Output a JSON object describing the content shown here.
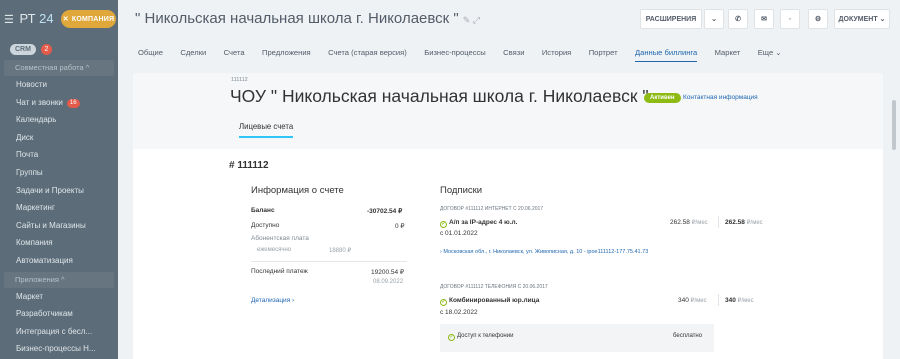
{
  "app": {
    "menu_icon": "menu-icon",
    "name": "РТ",
    "number": "24",
    "company_label": "КОМПАНИЯ"
  },
  "sidebar": {
    "crm_label": "CRM",
    "crm_count": "2",
    "group_work": "Совместная работа",
    "items_top": [
      {
        "label": "Новости",
        "count": ""
      },
      {
        "label": "Чат и звонки",
        "count": "16"
      },
      {
        "label": "Календарь",
        "count": ""
      },
      {
        "label": "Диск",
        "count": ""
      },
      {
        "label": "Почта",
        "count": ""
      },
      {
        "label": "Группы",
        "count": ""
      },
      {
        "label": "Задачи и Проекты",
        "count": ""
      },
      {
        "label": "Маркетинг",
        "count": ""
      },
      {
        "label": "Сайты и Магазины",
        "count": ""
      },
      {
        "label": "Компания",
        "count": ""
      },
      {
        "label": "Автоматизация",
        "count": ""
      }
    ],
    "group_apps": "Приложения",
    "items_bottom": [
      {
        "label": "Маркет"
      },
      {
        "label": "Разработчикам"
      },
      {
        "label": "Интеграция с бесл..."
      },
      {
        "label": "Бизнес-процессы Н..."
      }
    ]
  },
  "header": {
    "title": "\" Никольская начальная школа г. Николаевск \"",
    "extensions": "РАСШИРЕНИЯ",
    "document": "ДОКУМЕНТ"
  },
  "tabs": [
    {
      "label": "Общие",
      "active": false
    },
    {
      "label": "Сделки",
      "active": false
    },
    {
      "label": "Счета",
      "active": false
    },
    {
      "label": "Предложения",
      "active": false
    },
    {
      "label": "Счета (старая версия)",
      "active": false
    },
    {
      "label": "Бизнес-процессы",
      "active": false
    },
    {
      "label": "Связи",
      "active": false
    },
    {
      "label": "История",
      "active": false
    },
    {
      "label": "Портрет",
      "active": false
    },
    {
      "label": "Данные биллинга",
      "active": true
    },
    {
      "label": "Маркет",
      "active": false
    },
    {
      "label": "Еще ⌄",
      "active": false
    }
  ],
  "entity": {
    "id": "111112",
    "name": "ЧОУ \" Никольская начальная школа г. Николаевск \"",
    "status": "Активен",
    "contact_link": "Контактная информация",
    "subtab": "Лицевые счета"
  },
  "account": {
    "number": "# 111112",
    "info_title": "Информация о счете",
    "balance_label": "Баланс",
    "balance_value": "-30702.54 ₽",
    "available_label": "Доступно",
    "available_value": "0 ₽",
    "fee_label": "Абонентская плата",
    "fee_period": "ежемесячно",
    "fee_value": "18880 ₽",
    "last_payment_label": "Последний платеж",
    "last_payment_value": "19200.54 ₽",
    "last_payment_date": "08.09.2022",
    "details_link": "Детализация ›"
  },
  "subscriptions": {
    "title": "Подписки",
    "contract1": {
      "header": "ДОГОВОР #111112 ИНТЕРНЕТ С 20.06.2017",
      "service": "А/п за IP-адрес 4 ю.л.",
      "since": "с 01.01.2022",
      "price": "262.58",
      "unit": "₽/мес",
      "total": "262.58",
      "total_unit": "₽/мес",
      "address": "› Московская обл., г. Николаевск, ул. Живописная, д. 10 - ipoe111112-177.75.41.73"
    },
    "contract2": {
      "header": "ДОГОВОР #111112 ТЕЛЕФОНИЯ С 20.06.2017",
      "service": "Комбинированный юр.лица",
      "since": "с 18.02.2022",
      "price": "340",
      "unit": "₽/мес",
      "total": "340",
      "total_unit": "₽/мес",
      "feature": "Доступ к телефонии",
      "feature_price": "бесплатно"
    }
  }
}
